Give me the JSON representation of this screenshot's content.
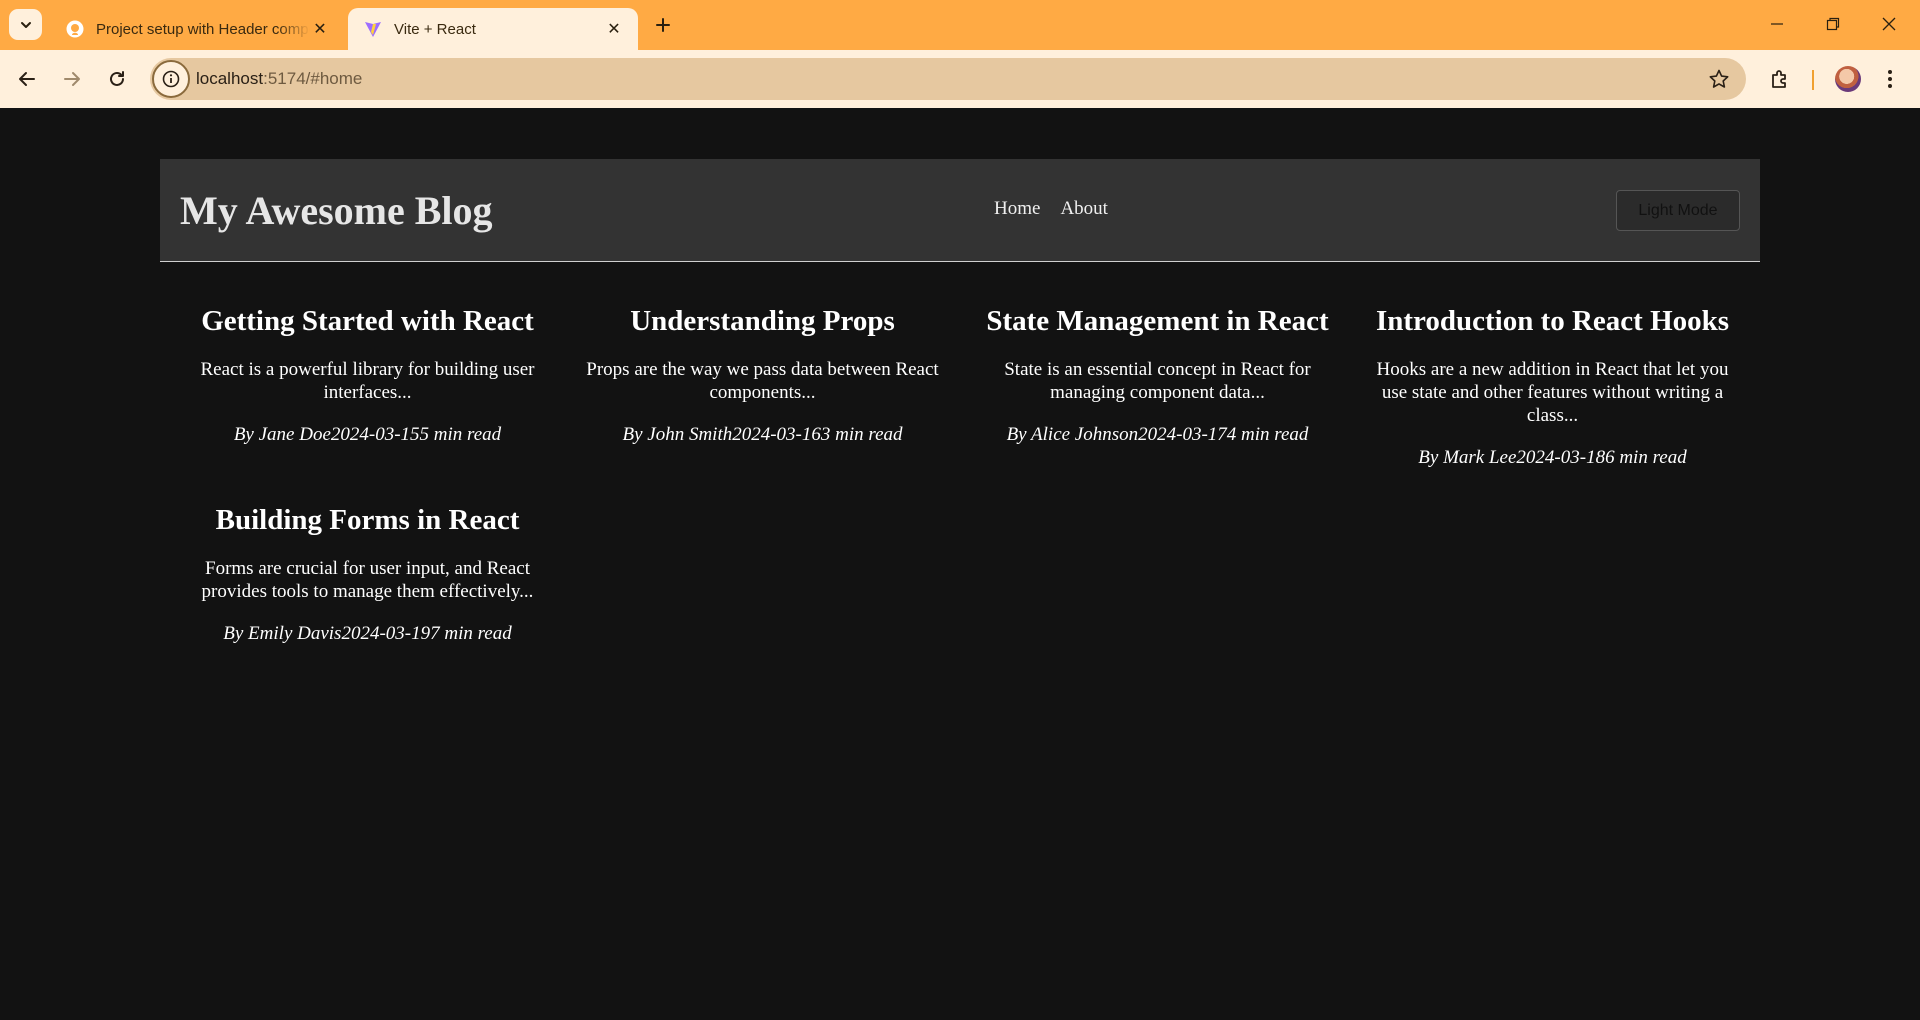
{
  "browser": {
    "tabs": [
      {
        "title": "Project setup with Header component",
        "favicon": "github-icon",
        "active": false
      },
      {
        "title": "Vite + React",
        "favicon": "vite-icon",
        "active": true
      }
    ],
    "url_host": "localhost",
    "url_path": ":5174/#home"
  },
  "site": {
    "title": "My Awesome Blog",
    "nav": {
      "home": "Home",
      "about": "About"
    },
    "mode_button": "Light Mode"
  },
  "posts": [
    {
      "title": "Getting Started with React",
      "excerpt": "React is a powerful library for building user interfaces...",
      "author": "By Jane Doe",
      "date": "2024-03-15",
      "read": "5 min read"
    },
    {
      "title": "Understanding Props",
      "excerpt": "Props are the way we pass data between React components...",
      "author": "By John Smith",
      "date": "2024-03-16",
      "read": "3 min read"
    },
    {
      "title": "State Management in React",
      "excerpt": "State is an essential concept in React for managing component data...",
      "author": "By Alice Johnson",
      "date": "2024-03-17",
      "read": "4 min read"
    },
    {
      "title": "Introduction to React Hooks",
      "excerpt": "Hooks are a new addition in React that let you use state and other features without writing a class...",
      "author": "By Mark Lee",
      "date": "2024-03-18",
      "read": "6 min read"
    },
    {
      "title": "Building Forms in React",
      "excerpt": "Forms are crucial for user input, and React provides tools to manage them effectively...",
      "author": "By Emily Davis",
      "date": "2024-03-19",
      "read": "7 min read"
    }
  ],
  "colors": {
    "chrome": "#ffaa44",
    "toolbar": "#fff0dc",
    "page_bg": "#121212",
    "header_bg": "#333333"
  }
}
